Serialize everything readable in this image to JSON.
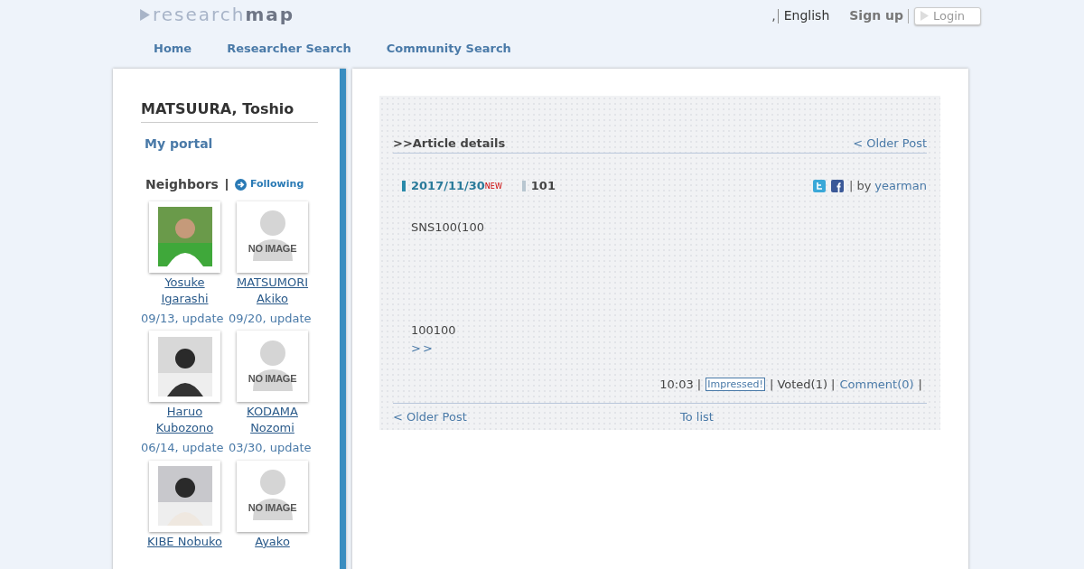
{
  "header": {
    "logo_light": "research",
    "logo_dark": "map",
    "lang_separator": ",",
    "language": "English",
    "signup": "Sign up",
    "login": "Login"
  },
  "nav": [
    "Home",
    "Researcher Search",
    "Community Search"
  ],
  "sidebar": {
    "name": "MATSUURA, Toshio",
    "portal": "My portal",
    "neighbors_title": "Neighbors",
    "following": "Following",
    "neighbors": [
      {
        "kind": "picture",
        "name": [
          "Yosuke",
          "Igarashi"
        ],
        "date": "09/13, update"
      },
      {
        "kind": "no_image",
        "placeholder_text": "NO IMAGE",
        "name": [
          "MATSUMORI",
          "Akiko"
        ],
        "date": "09/20, update"
      },
      {
        "kind": "picture",
        "name": [
          "Haruo",
          "Kubozono"
        ],
        "date": "06/14, update"
      },
      {
        "kind": "no_image",
        "placeholder_text": "NO IMAGE",
        "name": [
          "KODAMA",
          "Nozomi"
        ],
        "date": "03/30, update"
      },
      {
        "kind": "picture",
        "name": [
          "KIBE Nobuko"
        ]
      },
      {
        "kind": "no_image",
        "placeholder_text": "NO IMAGE",
        "name": [
          "Ayako"
        ]
      }
    ]
  },
  "article": {
    "heading": ">>Article details",
    "older_top": "< Older Post",
    "date": "2017/11/30",
    "new_badge": "NEW",
    "title": "101",
    "by": "| by",
    "author": "yearman",
    "body": [
      "SNS100(100",
      "100100"
    ],
    "more": ">>",
    "time": "10:03 |",
    "impressed": "Impressed!",
    "voted": "| Voted(1) |",
    "comment": "Comment(0)",
    "end_sep": "|",
    "older_bottom": "< Older Post",
    "to_list": "To list"
  }
}
